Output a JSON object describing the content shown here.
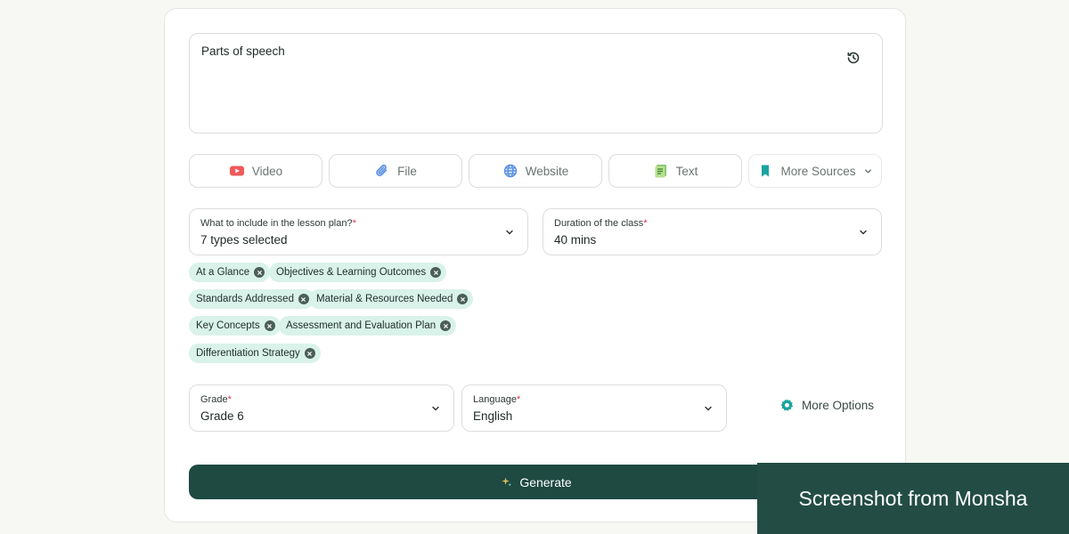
{
  "topic": {
    "text": "Parts of speech"
  },
  "sources": [
    {
      "label": "Video",
      "icon": "youtube-icon"
    },
    {
      "label": "File",
      "icon": "paperclip-icon"
    },
    {
      "label": "Website",
      "icon": "globe-icon"
    },
    {
      "label": "Text",
      "icon": "text-doc-icon"
    },
    {
      "label": "More Sources",
      "icon": "bookmark-icon"
    }
  ],
  "lesson_plan": {
    "label": "What to include in the lesson plan?",
    "required": "*",
    "value": "7 types selected"
  },
  "duration": {
    "label": "Duration of the class",
    "required": "*",
    "value": "40 mins"
  },
  "chips": [
    "At a Glance",
    "Objectives & Learning Outcomes",
    "Standards Addressed",
    "Material & Resources Needed",
    "Key Concepts",
    "Assessment and Evaluation Plan",
    "Differentiation Strategy"
  ],
  "grade": {
    "label": "Grade",
    "required": "*",
    "value": "Grade 6"
  },
  "language": {
    "label": "Language",
    "required": "*",
    "value": "English"
  },
  "more_options": {
    "label": "More Options"
  },
  "generate": {
    "label": "Generate"
  },
  "watermark": {
    "text": "Screenshot from Monsha"
  },
  "colors": {
    "primary": "#1e4a42",
    "chip_bg": "#d9f2ea",
    "required": "#d9324a",
    "youtube": "#f05a5a",
    "accent_teal": "#1ba3a0"
  }
}
